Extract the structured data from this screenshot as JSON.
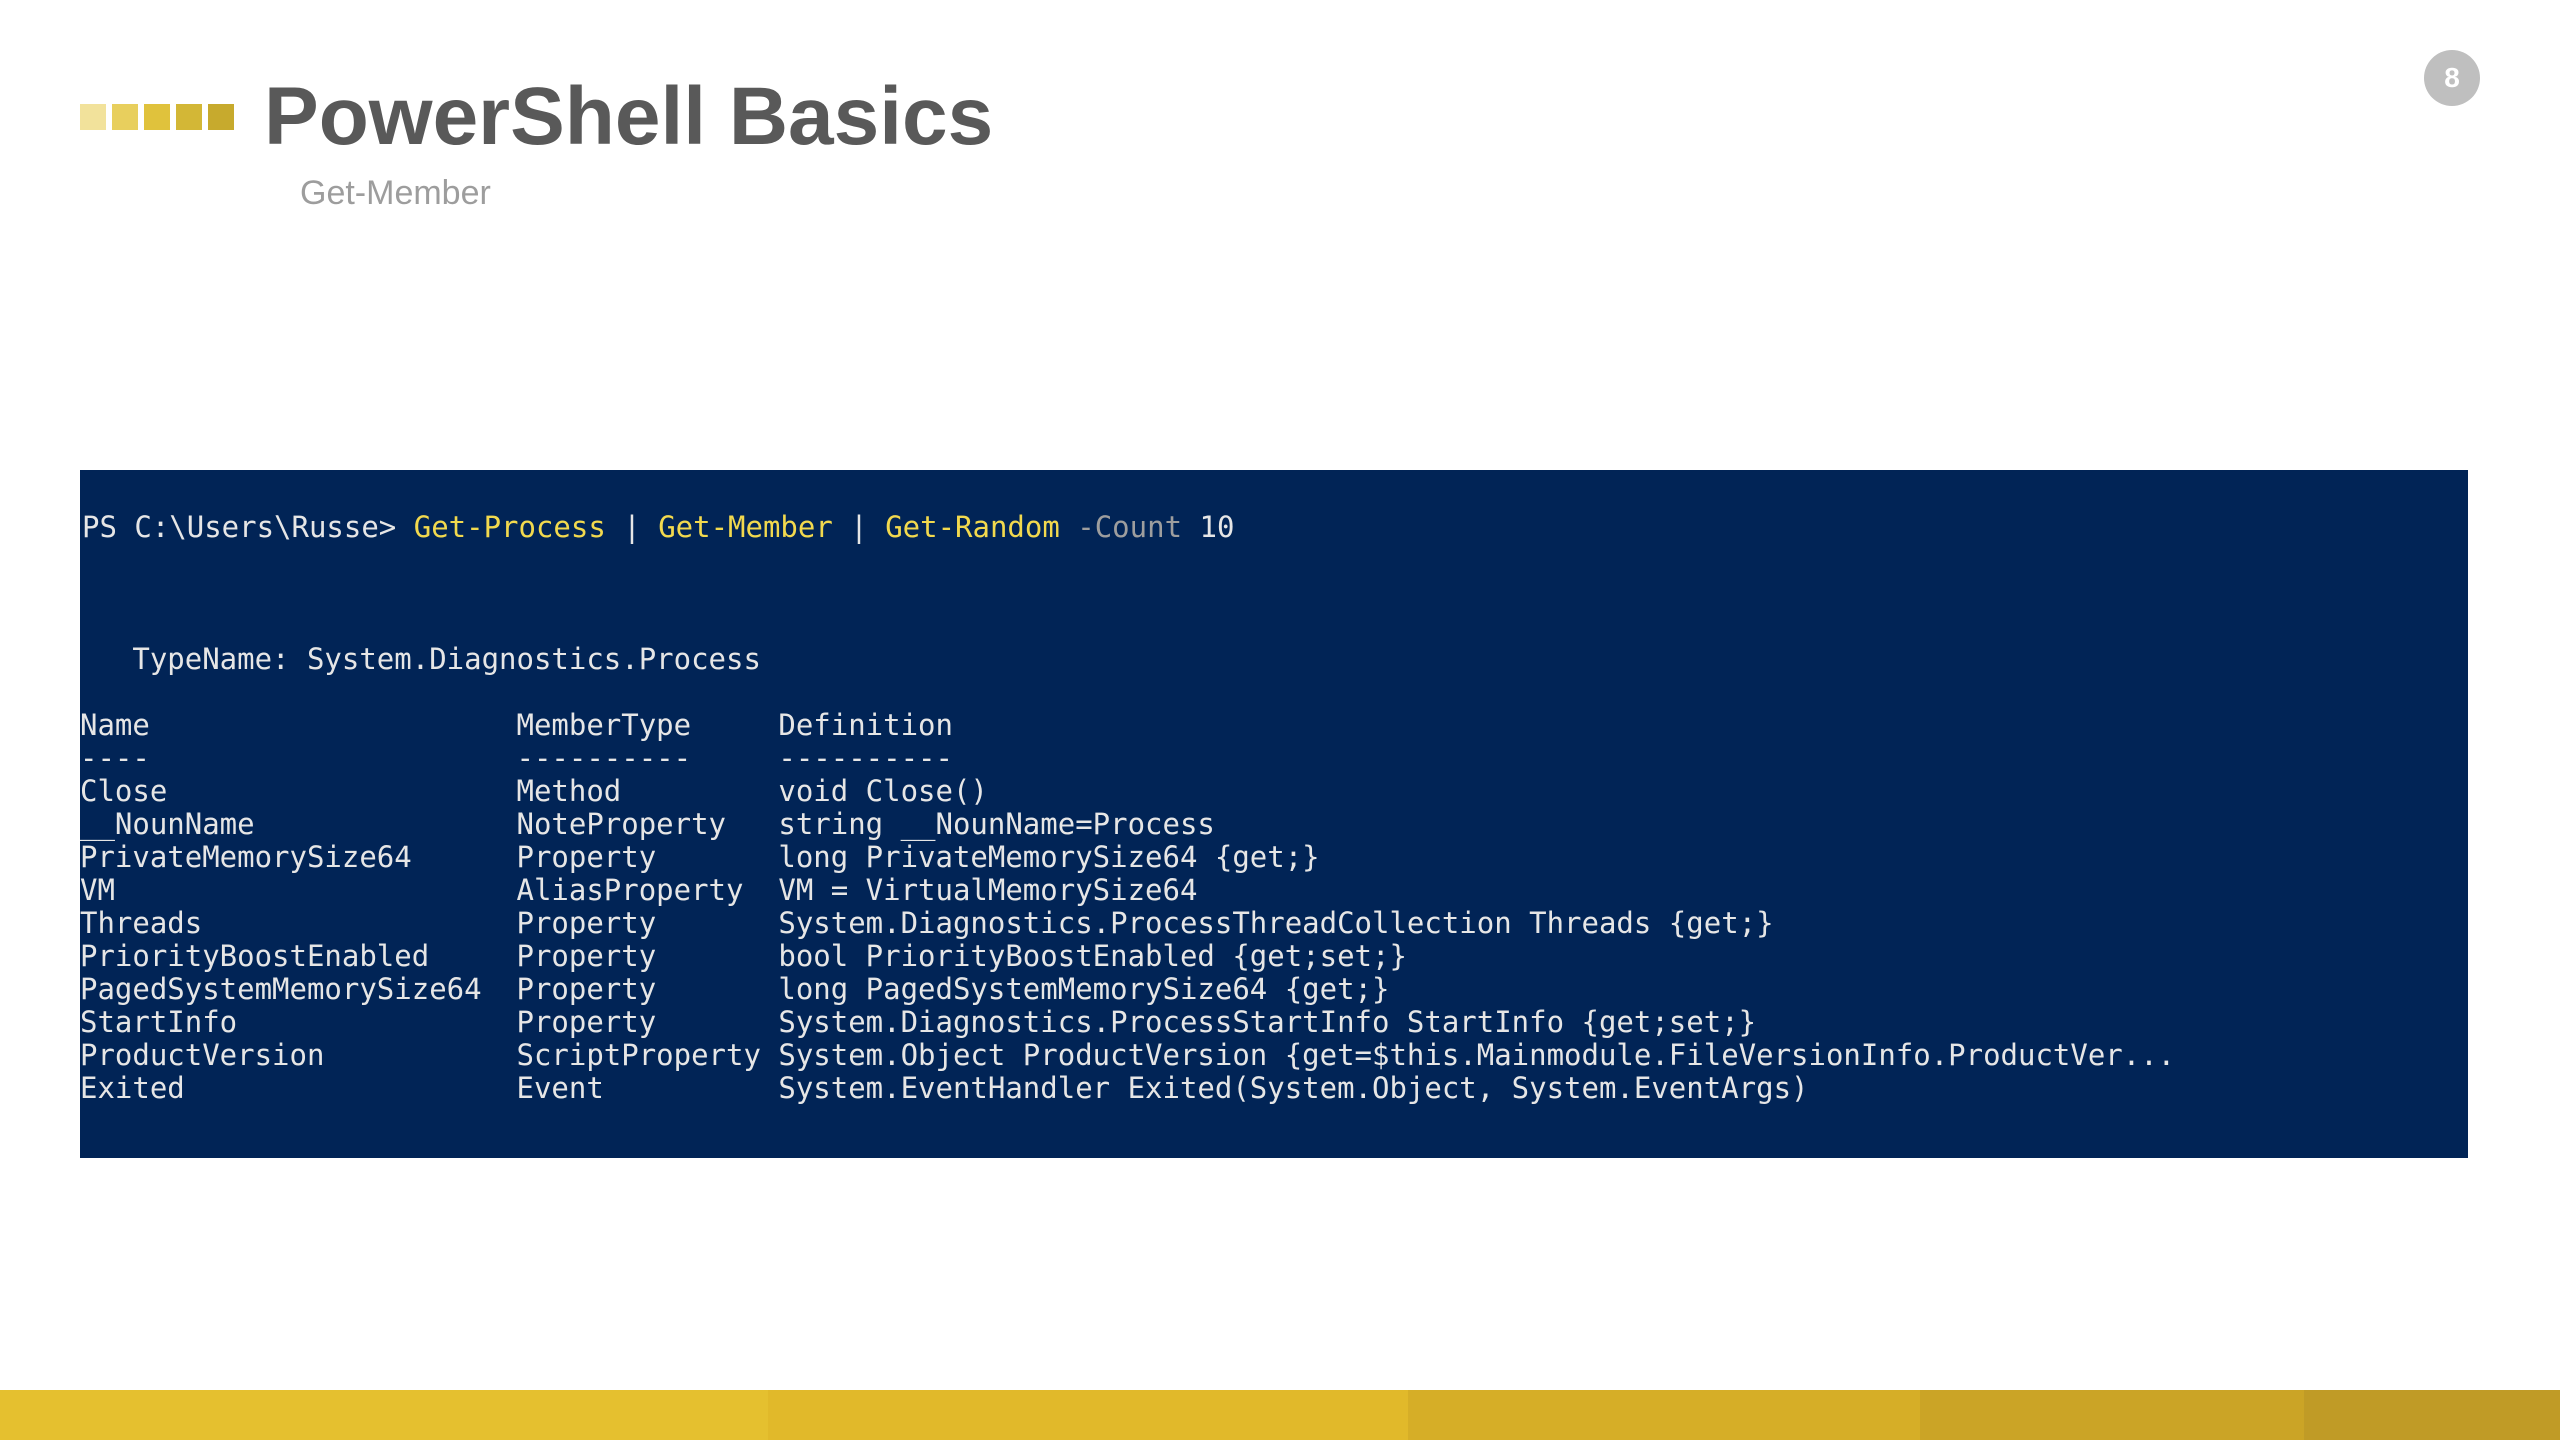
{
  "page_number": "8",
  "title": "PowerShell Basics",
  "subtitle": "Get-Member",
  "console": {
    "prompt": "PS C:\\Users\\Russe> ",
    "cmd_tokens": [
      {
        "t": "Get-Process",
        "c": "cmd"
      },
      {
        "t": " | ",
        "c": "arg"
      },
      {
        "t": "Get-Member",
        "c": "cmd"
      },
      {
        "t": " | ",
        "c": "arg"
      },
      {
        "t": "Get-Random",
        "c": "cmd"
      },
      {
        "t": " ",
        "c": "arg"
      },
      {
        "t": "-Count",
        "c": "param"
      },
      {
        "t": " 10",
        "c": "arg"
      }
    ],
    "typename_line": "   TypeName: System.Diagnostics.Process",
    "columns": {
      "name": "Name",
      "membertype": "MemberType",
      "definition": "Definition"
    },
    "col_widths": {
      "name": 25,
      "membertype": 15
    },
    "rows": [
      {
        "name": "Close",
        "membertype": "Method",
        "definition": "void Close()"
      },
      {
        "name": "__NounName",
        "membertype": "NoteProperty",
        "definition": "string __NounName=Process"
      },
      {
        "name": "PrivateMemorySize64",
        "membertype": "Property",
        "definition": "long PrivateMemorySize64 {get;}"
      },
      {
        "name": "VM",
        "membertype": "AliasProperty",
        "definition": "VM = VirtualMemorySize64"
      },
      {
        "name": "Threads",
        "membertype": "Property",
        "definition": "System.Diagnostics.ProcessThreadCollection Threads {get;}"
      },
      {
        "name": "PriorityBoostEnabled",
        "membertype": "Property",
        "definition": "bool PriorityBoostEnabled {get;set;}"
      },
      {
        "name": "PagedSystemMemorySize64",
        "membertype": "Property",
        "definition": "long PagedSystemMemorySize64 {get;}"
      },
      {
        "name": "StartInfo",
        "membertype": "Property",
        "definition": "System.Diagnostics.ProcessStartInfo StartInfo {get;set;}"
      },
      {
        "name": "ProductVersion",
        "membertype": "ScriptProperty",
        "definition": "System.Object ProductVersion {get=$this.Mainmodule.FileVersionInfo.ProductVer..."
      },
      {
        "name": "Exited",
        "membertype": "Event",
        "definition": "System.EventHandler Exited(System.Object, System.EventArgs)"
      }
    ]
  }
}
